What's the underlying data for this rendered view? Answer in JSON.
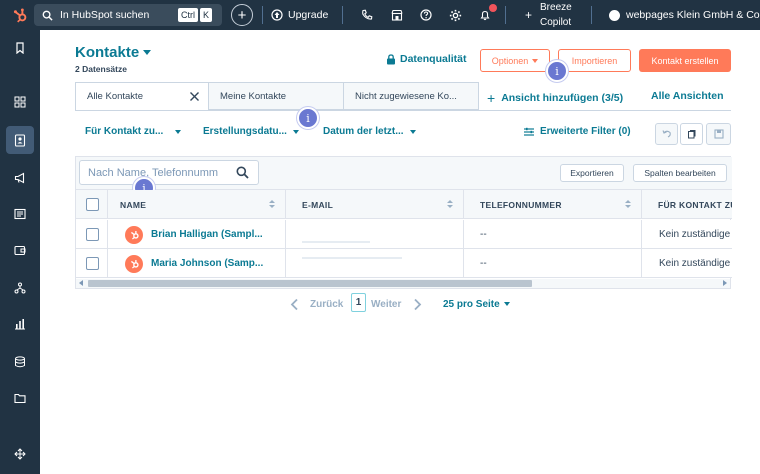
{
  "topbar": {
    "search_placeholder": "In HubSpot suchen",
    "shortcut_ctrl": "Ctrl",
    "shortcut_k": "K",
    "upgrade": "Upgrade",
    "breeze_line1": "Breeze",
    "breeze_line2": "Copilot",
    "account": "webpages Klein GmbH & Co."
  },
  "header": {
    "title": "Kontakte",
    "record_count": "2 Datensätze",
    "data_quality": "Datenqualität",
    "options": "Optionen",
    "import": "Importieren",
    "create_contact": "Kontakt erstellen"
  },
  "tabs": [
    {
      "label": "Alle Kontakte"
    },
    {
      "label": "Meine Kontakte"
    },
    {
      "label": "Nicht zugewiesene Ko..."
    }
  ],
  "add_view": "Ansicht hinzufügen (3/5)",
  "all_views": "Alle Ansichten",
  "filters": {
    "owner": "Für Kontakt zu...",
    "created": "Erstellungsdatu...",
    "last_activity": "Datum der letzt...",
    "advanced": "Erweiterte Filter (0)"
  },
  "table": {
    "search_placeholder": "Nach Name, Telefonnumm",
    "export": "Exportieren",
    "edit_columns": "Spalten bearbeiten",
    "columns": [
      "NAME",
      "E-MAIL",
      "TELEFONNUMMER",
      "FÜR KONTAKT ZU"
    ],
    "rows": [
      {
        "name": "Brian Halligan (Sampl...",
        "phone": "--",
        "owner": "Kein zuständige"
      },
      {
        "name": "Maria Johnson (Samp...",
        "phone": "--",
        "owner": "Kein zuständige"
      }
    ]
  },
  "pagination": {
    "prev": "Zurück",
    "page": "1",
    "next": "Weiter",
    "per_page": "25 pro Seite"
  },
  "info_badge": "i",
  "colors": {
    "nav_bg": "#213343",
    "link": "#0b7a93",
    "accent": "#ff7a59",
    "info": "#6a78d1"
  }
}
